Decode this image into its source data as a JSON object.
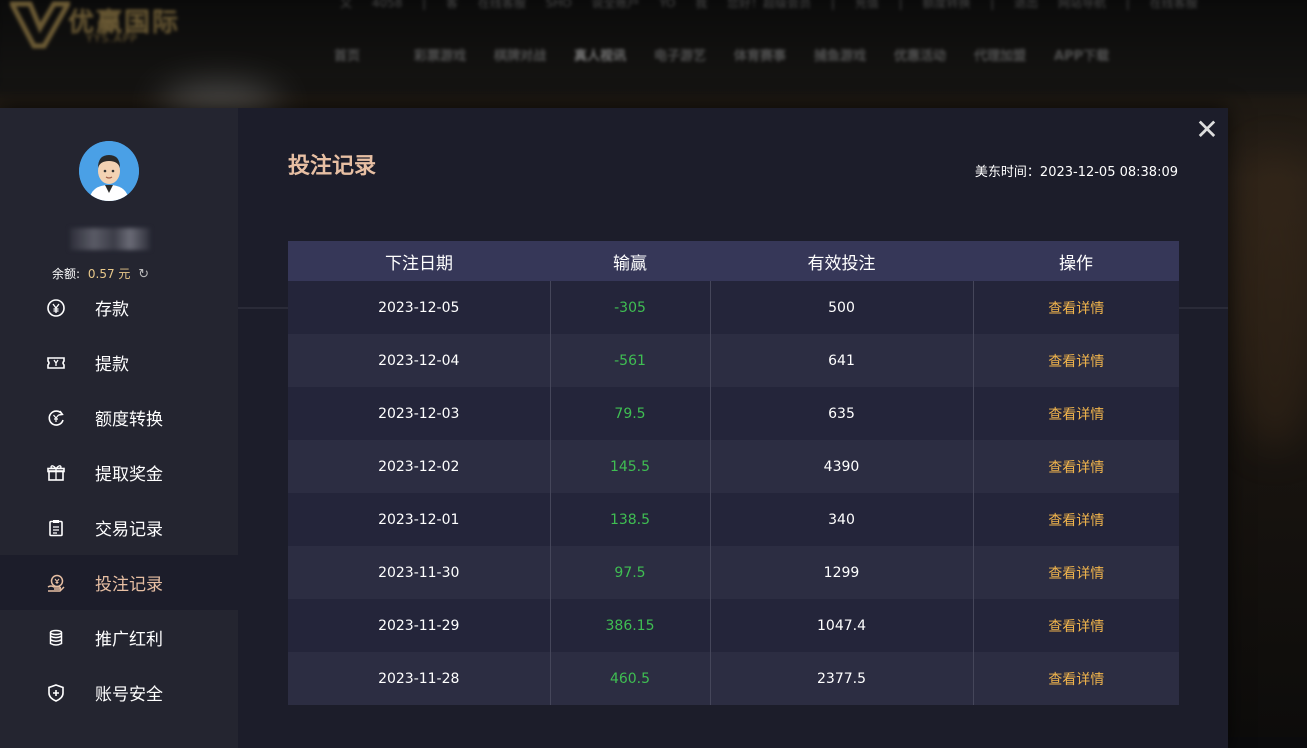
{
  "background": {
    "logo_text": "优赢国际",
    "logo_sub": "YYS.APP",
    "top_links": "又 4058 | 客 在线客服 SHO 说全账户 YO 我 您好！超级会员 | 充值 | 额度转换 | 退出 网站导航 | 在线客服",
    "nav": [
      "首页",
      "彩票游戏",
      "棋牌对战",
      "真人视讯",
      "电子游艺",
      "体育赛事",
      "捕鱼游戏",
      "优惠活动",
      "代理加盟",
      "APP下载"
    ]
  },
  "sidebar": {
    "balance_label": "余额:",
    "balance_value": "0.57 元",
    "refresh_icon": "↻",
    "items": [
      {
        "label": "存款",
        "icon": "yen-coin-icon"
      },
      {
        "label": "提款",
        "icon": "ticket-icon"
      },
      {
        "label": "额度转换",
        "icon": "exchange-icon"
      },
      {
        "label": "提取奖金",
        "icon": "gift-icon"
      },
      {
        "label": "交易记录",
        "icon": "clipboard-icon"
      },
      {
        "label": "投注记录",
        "icon": "bet-hand-icon",
        "active": true
      },
      {
        "label": "推广红利",
        "icon": "coins-stack-icon"
      },
      {
        "label": "账号安全",
        "icon": "shield-icon"
      }
    ]
  },
  "header": {
    "title": "投注记录",
    "time_label": "美东时间：",
    "time_value": "2023-12-05 08:38:09",
    "close_icon": "✕"
  },
  "table": {
    "headers": [
      "下注日期",
      "输赢",
      "有效投注",
      "操作"
    ],
    "rows": [
      {
        "date": "2023-12-05",
        "winloss": "-305",
        "valid_bet": "500",
        "action": "查看详情"
      },
      {
        "date": "2023-12-04",
        "winloss": "-561",
        "valid_bet": "641",
        "action": "查看详情"
      },
      {
        "date": "2023-12-03",
        "winloss": "79.5",
        "valid_bet": "635",
        "action": "查看详情"
      },
      {
        "date": "2023-12-02",
        "winloss": "145.5",
        "valid_bet": "4390",
        "action": "查看详情"
      },
      {
        "date": "2023-12-01",
        "winloss": "138.5",
        "valid_bet": "340",
        "action": "查看详情"
      },
      {
        "date": "2023-11-30",
        "winloss": "97.5",
        "valid_bet": "1299",
        "action": "查看详情"
      },
      {
        "date": "2023-11-29",
        "winloss": "386.15",
        "valid_bet": "1047.4",
        "action": "查看详情"
      },
      {
        "date": "2023-11-28",
        "winloss": "460.5",
        "valid_bet": "2377.5",
        "action": "查看详情"
      }
    ]
  },
  "colors": {
    "accent": "#e7bfa3",
    "win_color": "#3fbe52",
    "detail_color": "#f0b44c",
    "header_bg": "#363758"
  }
}
